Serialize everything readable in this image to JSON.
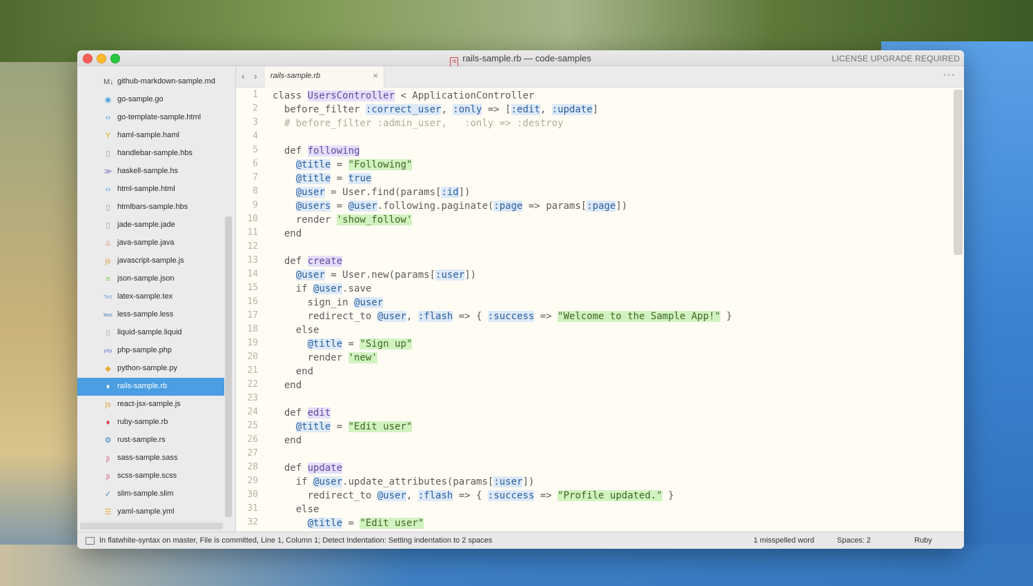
{
  "window": {
    "title": "rails-sample.rb — code-samples",
    "license_notice": "LICENSE UPGRADE REQUIRED"
  },
  "sidebar": {
    "files": [
      {
        "name": "github-markdown-sample.md",
        "icon": "markdown-icon"
      },
      {
        "name": "go-sample.go",
        "icon": "go-icon"
      },
      {
        "name": "go-template-sample.html",
        "icon": "code-icon"
      },
      {
        "name": "haml-sample.haml",
        "icon": "haml-icon"
      },
      {
        "name": "handlebar-sample.hbs",
        "icon": "file-icon"
      },
      {
        "name": "haskell-sample.hs",
        "icon": "haskell-icon"
      },
      {
        "name": "html-sample.html",
        "icon": "code-icon"
      },
      {
        "name": "htmlbars-sample.hbs",
        "icon": "file-icon"
      },
      {
        "name": "jade-sample.jade",
        "icon": "file-icon"
      },
      {
        "name": "java-sample.java",
        "icon": "java-icon"
      },
      {
        "name": "javascript-sample.js",
        "icon": "js-icon"
      },
      {
        "name": "json-sample.json",
        "icon": "json-icon"
      },
      {
        "name": "latex-sample.tex",
        "icon": "tex-icon"
      },
      {
        "name": "less-sample.less",
        "icon": "less-icon"
      },
      {
        "name": "liquid-sample.liquid",
        "icon": "file-icon"
      },
      {
        "name": "php-sample.php",
        "icon": "php-icon"
      },
      {
        "name": "python-sample.py",
        "icon": "python-icon"
      },
      {
        "name": "rails-sample.rb",
        "icon": "ruby-icon",
        "active": true
      },
      {
        "name": "react-jsx-sample.js",
        "icon": "js-icon"
      },
      {
        "name": "ruby-sample.rb",
        "icon": "ruby-icon"
      },
      {
        "name": "rust-sample.rs",
        "icon": "rust-icon"
      },
      {
        "name": "sass-sample.sass",
        "icon": "sass-icon"
      },
      {
        "name": "scss-sample.scss",
        "icon": "scss-icon"
      },
      {
        "name": "slim-sample.slim",
        "icon": "slim-icon"
      },
      {
        "name": "yaml-sample.yml",
        "icon": "yaml-icon"
      }
    ]
  },
  "tab": {
    "label": "rails-sample.rb",
    "close": "×"
  },
  "nav": {
    "back": "‹",
    "forward": "›",
    "more": "···"
  },
  "editor": {
    "lines": [
      "class UsersController < ApplicationController",
      "  before_filter :correct_user, :only => [:edit, :update]",
      "  # before_filter :admin_user,   :only => :destroy",
      "",
      "  def following",
      "    @title = \"Following\"",
      "    @title = true",
      "    @user = User.find(params[:id])",
      "    @users = @user.following.paginate(:page => params[:page])",
      "    render 'show_follow'",
      "  end",
      "",
      "  def create",
      "    @user = User.new(params[:user])",
      "    if @user.save",
      "      sign_in @user",
      "      redirect_to @user, :flash => { :success => \"Welcome to the Sample App!\" }",
      "    else",
      "      @title = \"Sign up\"",
      "      render 'new'",
      "    end",
      "  end",
      "",
      "  def edit",
      "    @title = \"Edit user\"",
      "  end",
      "",
      "  def update",
      "    if @user.update_attributes(params[:user])",
      "      redirect_to @user, :flash => { :success => \"Profile updated.\" }",
      "    else",
      "      @title = \"Edit user\""
    ]
  },
  "status": {
    "message": "In flatwhite-syntax on master, File is committed, Line 1, Column 1; Detect Indentation: Setting indentation to 2 spaces",
    "spelling": "1 misspelled word",
    "spaces": "Spaces: 2",
    "syntax": "Ruby"
  },
  "colors": {
    "accent": "#4a9ee1",
    "editor_bg": "#fffcf4",
    "highlight_purple": "#e4defc",
    "highlight_blue": "#dde9f8",
    "highlight_green": "#d2f2c2"
  }
}
